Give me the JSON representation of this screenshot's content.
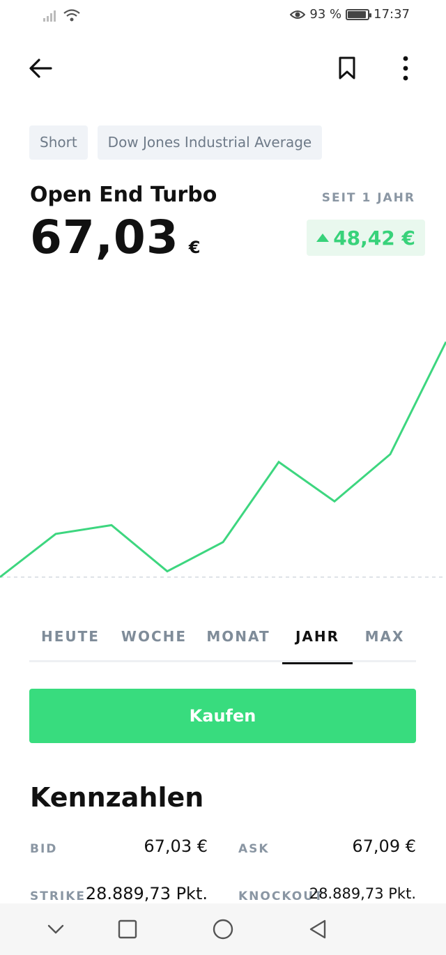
{
  "status_bar": {
    "battery_percent": "93 %",
    "battery_level": 0.93,
    "time": "17:37"
  },
  "toolbar": {
    "back_icon": "arrow-left-icon",
    "bookmark_icon": "bookmark-icon",
    "more_icon": "more-vertical-icon"
  },
  "chips": [
    "Short",
    "Dow Jones Industrial Average"
  ],
  "header": {
    "product_type": "Open End Turbo",
    "price": "67,03",
    "currency": "€",
    "period_label": "SEIT 1 JAHR",
    "change": "48,42 €",
    "change_direction": "up"
  },
  "chart_data": {
    "type": "line",
    "values": [
      18.61,
      27.5,
      29.3,
      19.8,
      25.8,
      42.3,
      34.2,
      43.9,
      67.03
    ],
    "baseline": 18.61,
    "ylim": [
      14,
      80
    ],
    "color": "#3dd67f",
    "grid": false
  },
  "tabs": [
    {
      "label": "HEUTE",
      "active": false
    },
    {
      "label": "WOCHE",
      "active": false
    },
    {
      "label": "MONAT",
      "active": false
    },
    {
      "label": "JAHR",
      "active": true
    },
    {
      "label": "MAX",
      "active": false
    }
  ],
  "buy_button": {
    "label": "Kaufen"
  },
  "kennzahlen": {
    "title": "Kennzahlen",
    "rows": [
      [
        {
          "label": "BID",
          "value": "67,03 €"
        },
        {
          "label": "ASK",
          "value": "67,09 €"
        }
      ],
      [
        {
          "label": "STRIKE",
          "value": "28.889,73 Pkt."
        },
        {
          "label": "KNOCKOUT",
          "value": "28.889,73 Pkt."
        }
      ]
    ]
  },
  "colors": {
    "accent_green": "#38dc7e",
    "positive": "#38d27a",
    "muted_text": "#8a96a3",
    "chip_bg": "#f0f3f7"
  }
}
